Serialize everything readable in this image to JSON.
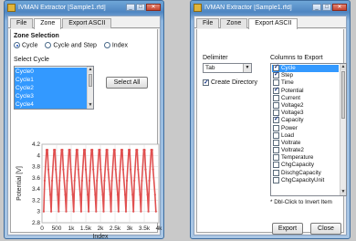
{
  "window_left": {
    "title": "IVMAN Extractor [Sample1.rfd]",
    "tabs": [
      "File",
      "Zone",
      "Export ASCII"
    ],
    "zone_selection": {
      "heading": "Zone Selection",
      "options": [
        "Cycle",
        "Cycle and Step",
        "Index"
      ],
      "selected": "Cycle"
    },
    "select_cycle": {
      "label": "Select Cycle",
      "items": [
        "Cycle0",
        "Cycle1",
        "Cycle2",
        "Cycle3",
        "Cycle4"
      ],
      "select_all_label": "Select All"
    },
    "chart_data": {
      "type": "line",
      "xlabel": "Index",
      "ylabel": "Potential [V]",
      "x_ticks": [
        "0",
        "500",
        "1k",
        "1.5k",
        "2k",
        "2.5k",
        "3k",
        "3.5k",
        "4k"
      ],
      "y_ticks": [
        "2.8",
        "3",
        "3.2",
        "3.4",
        "3.6",
        "3.8",
        "4",
        "4.2"
      ],
      "xlim": [
        0,
        4000
      ],
      "ylim": [
        2.8,
        4.2
      ],
      "grid": true,
      "series_color": "#e05050",
      "cycles": 15,
      "v_high": 4.1,
      "v_low": 3.0
    }
  },
  "window_right": {
    "title": "IVMAN Extractor [Sample1.rfd]",
    "tabs": [
      "File",
      "Zone",
      "Export ASCII"
    ],
    "delimiter": {
      "label": "Delimiter",
      "value": "Tab"
    },
    "create_directory": {
      "label": "Create Directory",
      "checked": true
    },
    "columns": {
      "label": "Columns to Export",
      "items": [
        {
          "name": "Cycle",
          "checked": true
        },
        {
          "name": "Step",
          "checked": true
        },
        {
          "name": "Time",
          "checked": false
        },
        {
          "name": "Potential",
          "checked": true
        },
        {
          "name": "Current",
          "checked": false
        },
        {
          "name": "Voltage2",
          "checked": false
        },
        {
          "name": "Voltage3",
          "checked": false
        },
        {
          "name": "Capacity",
          "checked": true
        },
        {
          "name": "Power",
          "checked": false
        },
        {
          "name": "Load",
          "checked": false
        },
        {
          "name": "Voltrate",
          "checked": false
        },
        {
          "name": "Voltrate2",
          "checked": false
        },
        {
          "name": "Temperature",
          "checked": false
        },
        {
          "name": "ChgCapacity",
          "checked": false
        },
        {
          "name": "DischgCapacity",
          "checked": false
        },
        {
          "name": "ChgCapacityUnit",
          "checked": false
        }
      ],
      "hint": "* Dbl-Click to Invert Item"
    },
    "export_label": "Export",
    "close_label": "Close"
  },
  "colors": {
    "accent": "#3399ff",
    "plot_line": "#e05050"
  }
}
